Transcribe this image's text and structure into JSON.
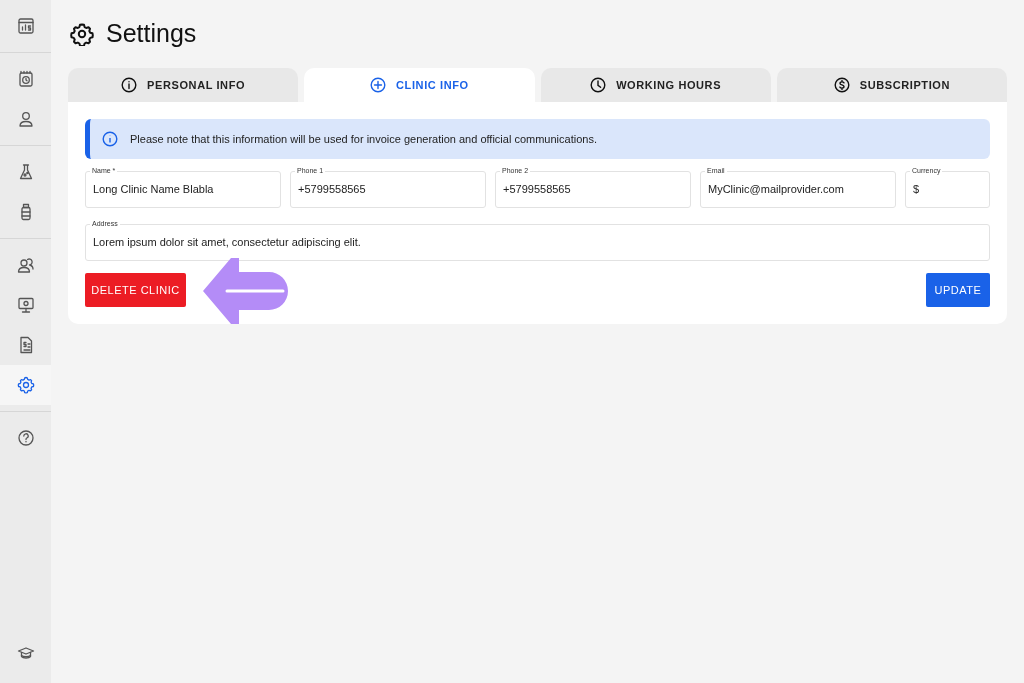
{
  "sidebar": {
    "groups": [
      {
        "items": [
          {
            "selected": false
          }
        ]
      },
      {
        "items": [
          {
            "selected": false
          },
          {
            "selected": false
          }
        ]
      },
      {
        "items": [
          {
            "selected": false
          },
          {
            "selected": false
          }
        ]
      },
      {
        "items": [
          {
            "selected": false
          },
          {
            "selected": false
          },
          {
            "selected": false
          },
          {
            "selected": true
          }
        ]
      },
      {
        "items": [
          {
            "selected": false
          }
        ]
      }
    ],
    "bottom_items": [
      {
        "selected": false
      }
    ]
  },
  "page": {
    "title": "Settings"
  },
  "tabs": [
    {
      "label": "PERSONAL INFO",
      "selected": false
    },
    {
      "label": "CLINIC INFO",
      "selected": true
    },
    {
      "label": "WORKING HOURS",
      "selected": false
    },
    {
      "label": "SUBSCRIPTION",
      "selected": false
    }
  ],
  "notice": "Please note that this information will be used for invoice generation and official communications.",
  "fields": [
    {
      "label": "Name *",
      "value": "Long Clinic Name Blabla"
    },
    {
      "label": "Phone 1",
      "value": "+5799558565"
    },
    {
      "label": "Phone 2",
      "value": "+5799558565"
    },
    {
      "label": "Email",
      "value": "MyClinic@mailprovider.com"
    },
    {
      "label": "Currency",
      "value": "$"
    }
  ],
  "address": {
    "label": "Address",
    "value": "Lorem ipsum dolor sit amet, consectetur adipiscing elit."
  },
  "buttons": {
    "delete": "DELETE CLINIC",
    "update": "UPDATE"
  }
}
